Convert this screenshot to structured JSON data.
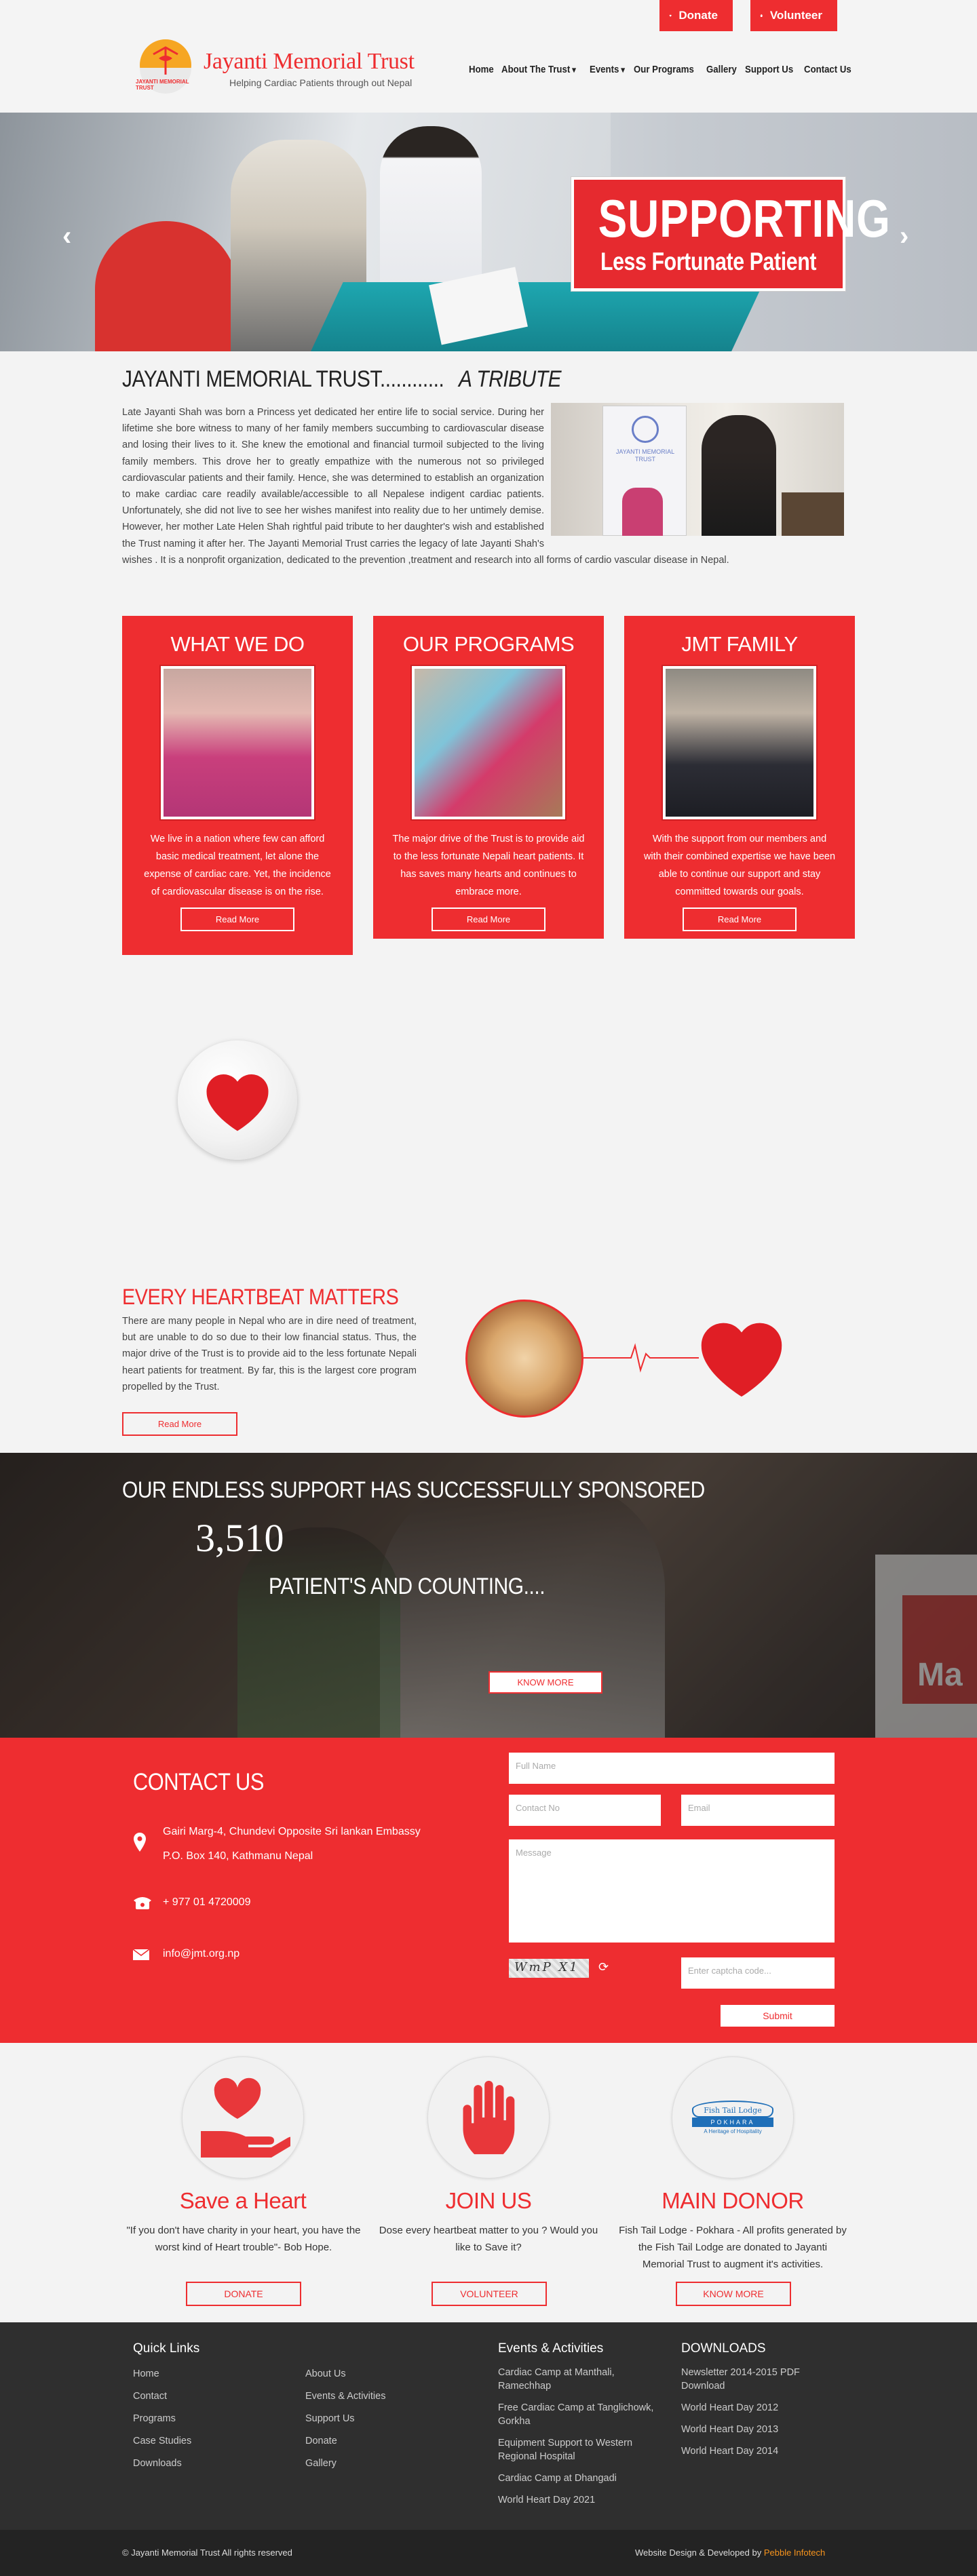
{
  "header": {
    "donate_label": "Donate",
    "volunteer_label": "Volunteer",
    "logo_badge": "JAYANTI MEMORIAL TRUST",
    "brand": "Jayanti Memorial Trust",
    "tagline": "Helping Cardiac Patients through out Nepal",
    "nav": [
      "Home",
      "About The Trust",
      "Events",
      "Our Programs",
      "Gallery",
      "Support Us",
      "Contact Us"
    ]
  },
  "hero": {
    "line1": "SUPPORTING",
    "line2": "Less Fortunate Patient",
    "prev": "‹",
    "next": "›"
  },
  "tribute": {
    "title_main": "JAYANTI MEMORIAL TRUST............",
    "title_em": "A TRIBUTE",
    "body": "Late Jayanti Shah was born a Princess yet dedicated her entire life to social service. During her lifetime she bore witness to many of her family members succumbing to cardiovascular disease and losing their lives to it. She knew the emotional and financial turmoil subjected to the living family members. This drove her to greatly empathize with the numerous not so privileged cardiovascular patients and their family. Hence, she was determined to establish an organization to make cardiac care readily available/accessible to all Nepalese indigent cardiac patients. Unfortunately, she did not live to see her wishes manifest into reality due to her untimely demise. However, her mother Late Helen Shah rightful paid tribute to her daughter's wish and established the Trust naming it after her. The Jayanti Memorial Trust carries the legacy of late Jayanti Shah's wishes . It is a nonprofit organization, dedicated to the prevention ,treatment and research into all forms of cardio vascular disease in Nepal.",
    "banner_text": "JAYANTI MEMORIAL TRUST"
  },
  "cards": [
    {
      "title": "WHAT WE DO",
      "text": "We live in a nation where few can afford basic medical treatment, let alone the expense of cardiac care. Yet, the incidence of cardiovascular disease is on the rise.",
      "button": "Read More"
    },
    {
      "title": "OUR PROGRAMS",
      "text": "The major drive of the Trust is to provide aid to the less fortunate Nepali heart patients. It has saves many hearts and continues to embrace more.",
      "button": "Read More"
    },
    {
      "title": "JMT FAMILY",
      "text": "With the support from our members and with their combined expertise we have been able to continue our support and stay committed towards our goals.",
      "button": "Read More"
    }
  ],
  "heartbeat": {
    "title": "EVERY HEARTBEAT MATTERS",
    "text": "There are many people in Nepal who are in dire need of treatment, but are unable to do so due to their low financial status. Thus, the major drive of the Trust is to provide aid to the less fortunate Nepali heart patients for treatment. By far, this is the largest core program propelled by the Trust.",
    "button": "Read More"
  },
  "sponsor": {
    "line1": "OUR ENDLESS SUPPORT HAS SUCCESSFULLY SPONSORED",
    "count": "3,510",
    "line2": "PATIENT'S AND COUNTING....",
    "button": "KNOW MORE",
    "booth_text": "Ma"
  },
  "contact": {
    "title": "CONTACT US",
    "address1": "Gairi Marg-4, Chundevi Opposite Sri lankan Embassy",
    "address2": "P.O. Box 140, Kathmanu Nepal",
    "phone": "+ 977 01 4720009",
    "email": "info@jmt.org.np",
    "form": {
      "name_ph": "Full Name",
      "contact_ph": "Contact No",
      "email_ph": "Email",
      "message_ph": "Message",
      "captcha_text": "WmP X1",
      "captcha_ph": "Enter captcha code...",
      "submit": "Submit"
    }
  },
  "features": [
    {
      "title": "Save a Heart",
      "text": "\"If you don't have charity in your heart, you have the worst kind of Heart trouble\"- Bob Hope.",
      "button": "DONATE"
    },
    {
      "title": "JOIN US",
      "text": "Dose every heartbeat matter to you ? Would you like to Save it?",
      "button": "VOLUNTEER"
    },
    {
      "title": "MAIN DONOR",
      "text": "Fish Tail Lodge - Pokhara - All profits generated by the Fish Tail Lodge are donated to Jayanti Memorial Trust to augment it's activities.",
      "button": "KNOW MORE",
      "logo_top": "Fish Tail Lodge",
      "logo_mid": "POKHARA",
      "logo_bottom": "A Heritage of Hospitality"
    }
  ],
  "footer": {
    "quick_links_title": "Quick Links",
    "col1": [
      "Home",
      "Contact",
      "Programs",
      "Case Studies",
      "Downloads"
    ],
    "col2": [
      "About Us",
      "Events & Activities",
      "Support Us",
      "Donate",
      "Gallery"
    ],
    "events_title": "Events & Activities",
    "events": [
      "Cardiac Camp at Manthali, Ramechhap",
      "Free Cardiac Camp at Tanglichowk, Gorkha",
      "Equipment Support to Western Regional Hospital",
      "Cardiac Camp at Dhangadi",
      "World Heart Day 2021"
    ],
    "downloads_title": "DOWNLOADS",
    "downloads": [
      "Newsletter 2014-2015 PDF Download",
      "World Heart Day 2012",
      "World Heart Day 2013",
      "World Heart Day 2014"
    ],
    "copyright": "© Jayanti Memorial Trust All rights reserved",
    "credit_prefix": "Website Design & Developed by",
    "credit_name": "Pebble Infotech"
  },
  "colors": {
    "brand_red": "#ee2d30",
    "footer_dark": "#2f2f2f",
    "credit_orange": "#f7941d"
  }
}
